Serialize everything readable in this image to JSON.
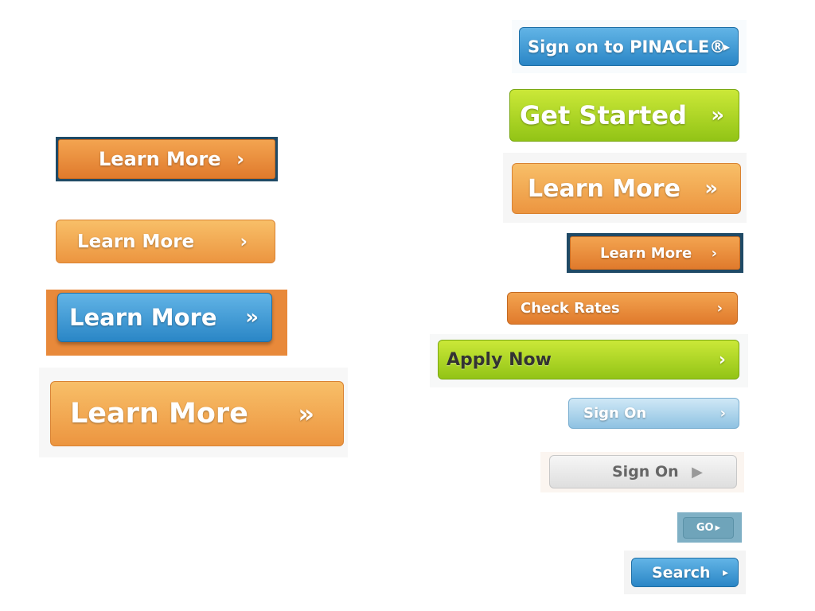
{
  "buttons": [
    {
      "label": "Learn More",
      "arrow": "›"
    },
    {
      "label": "Learn More",
      "arrow": "›"
    },
    {
      "label": "Learn More",
      "arrow": "»"
    },
    {
      "label": "Learn More",
      "arrow": "»"
    },
    {
      "label": "Sign on to PINACLE®",
      "arrow": "▸"
    },
    {
      "label": "Get Started",
      "arrow": "»"
    },
    {
      "label": "Learn More",
      "arrow": "»"
    },
    {
      "label": "Learn More",
      "arrow": "›"
    },
    {
      "label": "Check Rates",
      "arrow": "›"
    },
    {
      "label": "Apply Now",
      "arrow": "›"
    },
    {
      "label": "Sign On",
      "arrow": "›"
    },
    {
      "label": "Sign On",
      "arrow": "▶"
    },
    {
      "label": "GO",
      "arrow": "▸"
    },
    {
      "label": "Search",
      "arrow": "▸"
    }
  ],
  "colors": {
    "orange": "#ec9540",
    "blue": "#2a86c6",
    "green": "#92c416",
    "light_blue": "#8fc2e2",
    "gray": "#dedede",
    "frame_navy": "#1f4a66",
    "frame_orange": "#e8893a",
    "frame_go": "#7fb0c5"
  }
}
